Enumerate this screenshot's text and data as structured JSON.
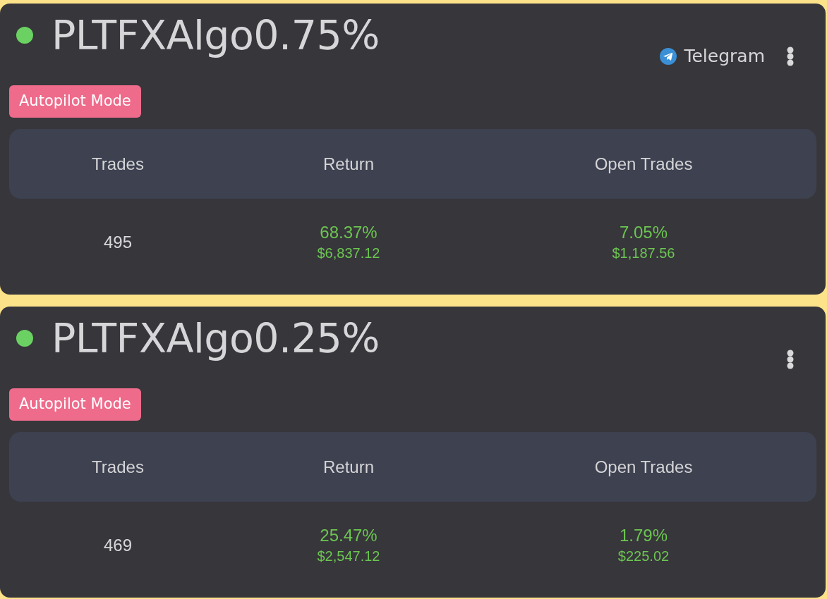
{
  "strategies": [
    {
      "name": "PLTFXAlgo0.75%",
      "active": true,
      "telegram": "Telegram",
      "mode_badge": "Autopilot Mode",
      "columns": [
        "Trades",
        "Return",
        "Open Trades"
      ],
      "trades": "495",
      "return": {
        "percent": "68.37%",
        "amount": "$6,837.12"
      },
      "open_trades": {
        "percent": "7.05%",
        "amount": "$1,187.56"
      }
    },
    {
      "name": "PLTFXAlgo0.25%",
      "active": true,
      "mode_badge": "Autopilot Mode",
      "columns": [
        "Trades",
        "Return",
        "Open Trades"
      ],
      "trades": "469",
      "return": {
        "percent": "25.47%",
        "amount": "$2,547.12"
      },
      "open_trades": {
        "percent": "1.79%",
        "amount": "$225.02"
      }
    }
  ]
}
